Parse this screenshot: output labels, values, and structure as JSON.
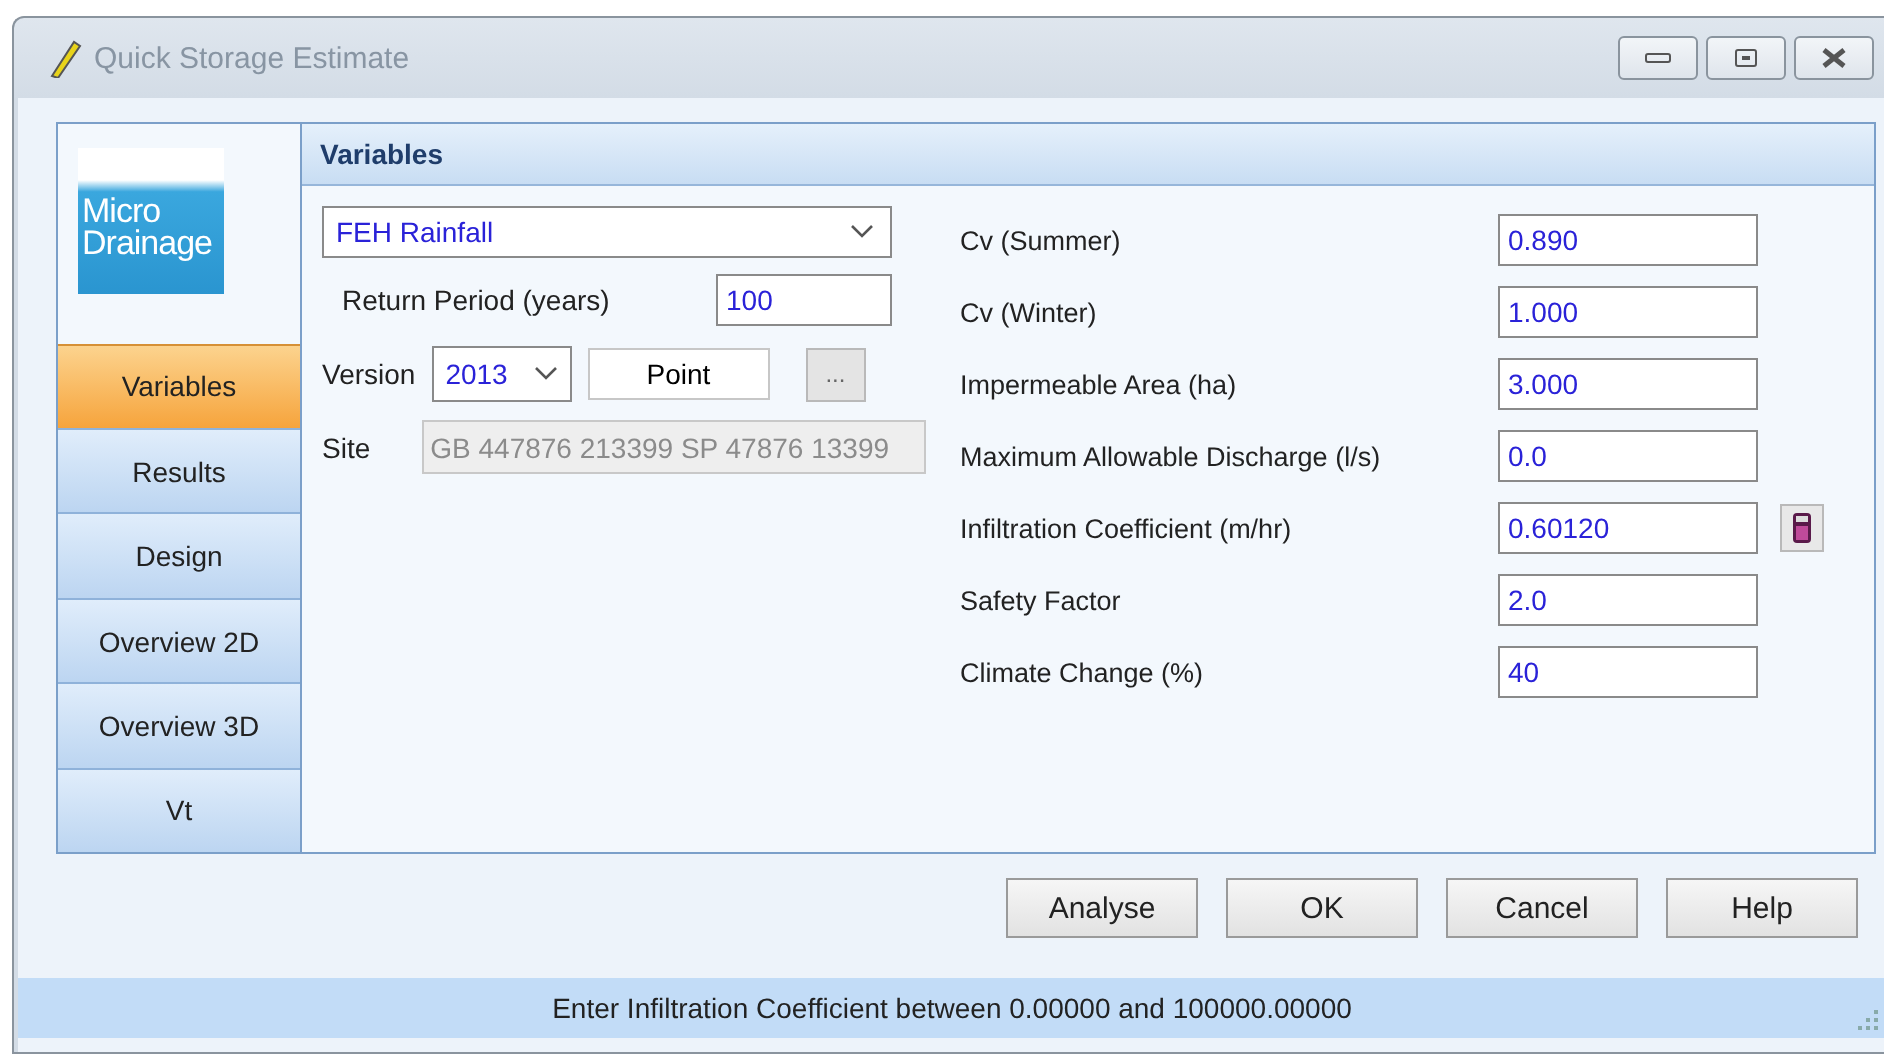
{
  "window": {
    "title": "Quick Storage Estimate"
  },
  "logo": {
    "lines": [
      "Micro",
      "Drainage"
    ]
  },
  "nav": [
    {
      "label": "Variables",
      "selected": true
    },
    {
      "label": "Results",
      "selected": false
    },
    {
      "label": "Design",
      "selected": false
    },
    {
      "label": "Overview 2D",
      "selected": false
    },
    {
      "label": "Overview 3D",
      "selected": false
    },
    {
      "label": "Vt",
      "selected": false
    }
  ],
  "panel_title": "Variables",
  "rainfall": {
    "model": "FEH Rainfall",
    "return_period_label": "Return Period (years)",
    "return_period": "100",
    "version_label": "Version",
    "version": "2013",
    "point_button": "Point",
    "browse_button": "...",
    "site_label": "Site",
    "site": "GB 447876 213399 SP 47876 13399"
  },
  "parameters": [
    {
      "label": "Cv (Summer)",
      "value": "0.890",
      "kind": "field"
    },
    {
      "label": "Cv (Winter)",
      "value": "1.000",
      "kind": "field"
    },
    {
      "label": "Impermeable Area (ha)",
      "value": "3.000",
      "kind": "field"
    },
    {
      "label": "Maximum Allowable Discharge (l/s)",
      "value": "0.0",
      "kind": "field"
    },
    {
      "label": "Infiltration Coefficient (m/hr)",
      "value": "0.60120",
      "kind": "calculator"
    },
    {
      "label": "Safety Factor",
      "value": "2.0",
      "kind": "field"
    },
    {
      "label": "Climate Change (%)",
      "value": "40",
      "kind": "field"
    }
  ],
  "buttons": [
    "Analyse",
    "OK",
    "Cancel",
    "Help"
  ],
  "status_bar": "Enter Infiltration Coefficient between 0.00000 and 100000.00000"
}
